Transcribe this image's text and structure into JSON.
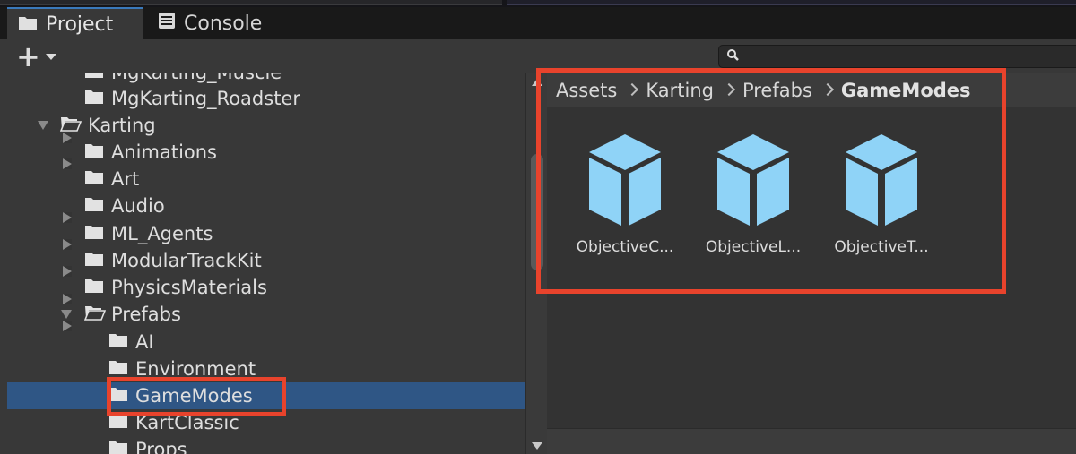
{
  "tabs": [
    {
      "label": "Project",
      "icon": "folder-icon",
      "active": true
    },
    {
      "label": "Console",
      "icon": "console-icon",
      "active": false
    }
  ],
  "toolbar": {
    "create_label": "+",
    "search_placeholder": ""
  },
  "tree": [
    {
      "label": "MgKarting_Muscle",
      "indent": 1,
      "arrow": "right",
      "open": false
    },
    {
      "label": "MgKarting_Roadster",
      "indent": 1,
      "arrow": "right",
      "open": false
    },
    {
      "label": "Karting",
      "indent": 0,
      "arrow": "down",
      "open": true
    },
    {
      "label": "Animations",
      "indent": 1,
      "arrow": "right",
      "open": false
    },
    {
      "label": "Art",
      "indent": 1,
      "arrow": "right",
      "open": false
    },
    {
      "label": "Audio",
      "indent": 1,
      "arrow": "right",
      "open": false
    },
    {
      "label": "ML_Agents",
      "indent": 1,
      "arrow": "right",
      "open": false
    },
    {
      "label": "ModularTrackKit",
      "indent": 1,
      "arrow": "right",
      "open": false
    },
    {
      "label": "PhysicsMaterials",
      "indent": 1,
      "arrow": "none",
      "open": false
    },
    {
      "label": "Prefabs",
      "indent": 1,
      "arrow": "down",
      "open": true
    },
    {
      "label": "AI",
      "indent": 2,
      "arrow": "none",
      "open": false
    },
    {
      "label": "Environment",
      "indent": 2,
      "arrow": "none",
      "open": false
    },
    {
      "label": "GameModes",
      "indent": 2,
      "arrow": "none",
      "open": false,
      "selected": true
    },
    {
      "label": "KartClassic",
      "indent": 2,
      "arrow": "none",
      "open": false
    },
    {
      "label": "Props",
      "indent": 2,
      "arrow": "none",
      "open": false
    }
  ],
  "breadcrumb": [
    "Assets",
    "Karting",
    "Prefabs",
    "GameModes"
  ],
  "assets": [
    {
      "name": "ObjectiveC...",
      "icon": "prefab-cube-icon"
    },
    {
      "name": "ObjectiveL...",
      "icon": "prefab-cube-icon"
    },
    {
      "name": "ObjectiveT...",
      "icon": "prefab-cube-icon"
    }
  ],
  "colors": {
    "selection": "#2f5685",
    "highlight": "#e8432c",
    "prefab": "#8fd3f7",
    "tab_accent": "#3a79bb"
  }
}
